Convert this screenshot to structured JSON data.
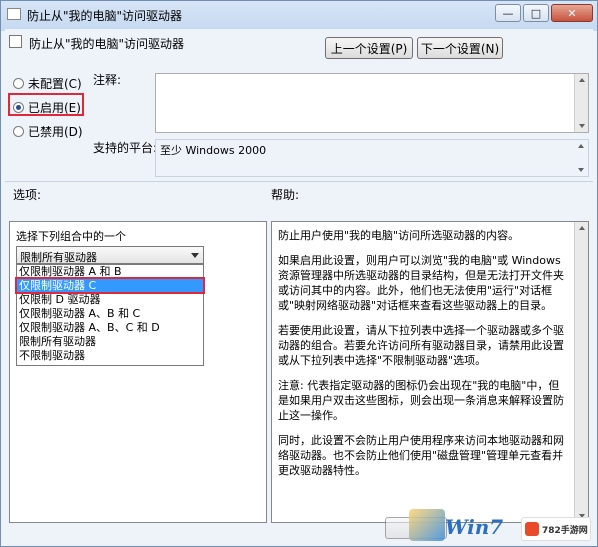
{
  "window": {
    "title": "防止从\"我的电脑\"访问驱动器",
    "controls": {
      "minimize": "—",
      "maximize": "□",
      "close": "✕"
    }
  },
  "header": {
    "policy_title": "防止从\"我的电脑\"访问驱动器",
    "prev_button": "上一个设置(P)",
    "next_button": "下一个设置(N)"
  },
  "state": {
    "options": [
      {
        "label": "未配置(C)",
        "checked": false
      },
      {
        "label": "已启用(E)",
        "checked": true
      },
      {
        "label": "已禁用(D)",
        "checked": false
      }
    ]
  },
  "comment": {
    "label": "注释:",
    "value": ""
  },
  "platform": {
    "label": "支持的平台:",
    "value": "至少 Windows 2000"
  },
  "options_section": {
    "label": "选项:",
    "combo_label": "选择下列组合中的一个",
    "selected": "限制所有驱动器",
    "list": [
      "仅限制驱动器 A 和 B",
      "仅限制驱动器 C",
      "仅限制 D 驱动器",
      "仅限制驱动器 A、B 和 C",
      "仅限制驱动器 A、B、C 和 D",
      "限制所有驱动器",
      "不限制驱动器"
    ],
    "highlighted_index": 1
  },
  "help_section": {
    "label": "帮助:",
    "paragraphs": [
      "防止用户使用\"我的电脑\"访问所选驱动器的内容。",
      "如果启用此设置，则用户可以浏览\"我的电脑\"或 Windows 资源管理器中所选驱动器的目录结构，但是无法打开文件夹或访问其中的内容。此外，他们也无法使用\"运行\"对话框或\"映射网络驱动器\"对话框来查看这些驱动器上的目录。",
      "若要使用此设置，请从下拉列表中选择一个驱动器或多个驱动器的组合。若要允许访问所有驱动器目录，请禁用此设置或从下拉列表中选择\"不限制驱动器\"选项。",
      "注意: 代表指定驱动器的图标仍会出现在\"我的电脑\"中，但是如果用户双击这些图标，则会出现一条消息来解释设置防止这一操作。",
      "同时，此设置不会防止用户使用程序来访问本地驱动器和网络驱动器。也不会防止他们使用\"磁盘管理\"管理单元查看并更改驱动器特性。"
    ]
  },
  "watermark": {
    "brand": "Win7",
    "site": "782手游网"
  }
}
